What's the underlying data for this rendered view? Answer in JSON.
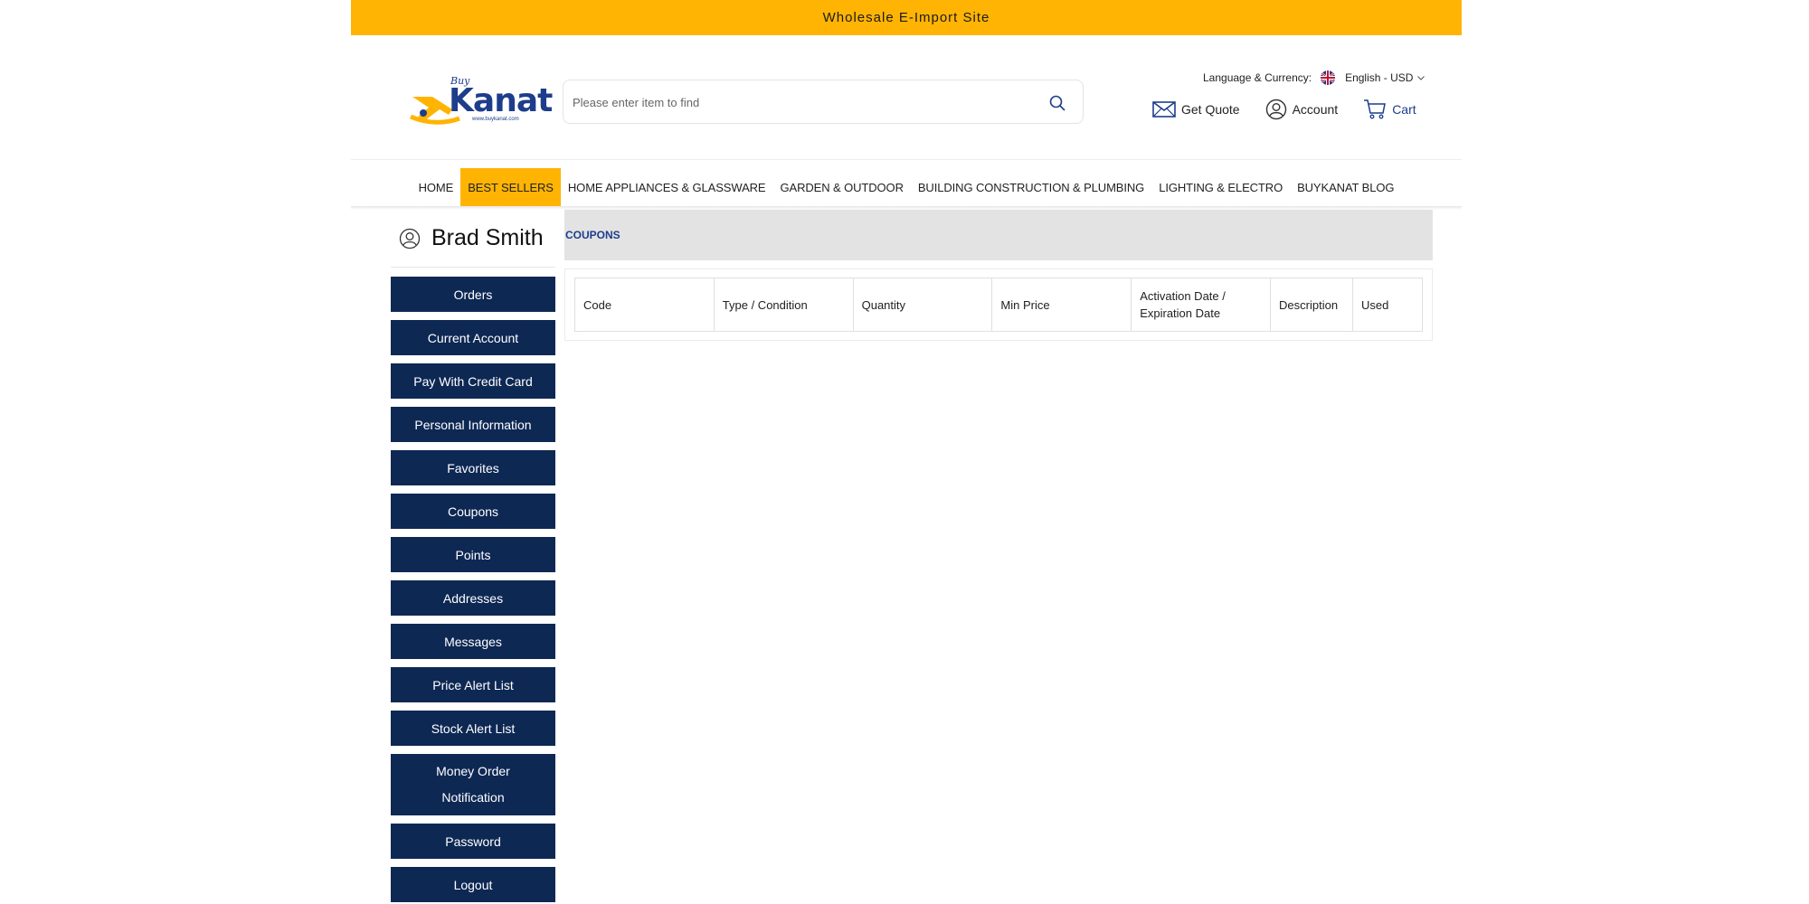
{
  "topbar": {
    "text": "Wholesale E-Import Site"
  },
  "logo": {
    "buy": "Buy",
    "name": "Kanat",
    "url": "www.buykanat.com"
  },
  "search": {
    "placeholder": "Please enter item to find"
  },
  "header": {
    "language_label": "Language & Currency:",
    "language_value": "English - USD",
    "get_quote": "Get Quote",
    "account": "Account",
    "cart": "Cart"
  },
  "nav": {
    "items": [
      {
        "label": "HOME"
      },
      {
        "label": "BEST SELLERS"
      },
      {
        "label": "HOME APPLIANCES & GLASSWARE"
      },
      {
        "label": "GARDEN & OUTDOOR"
      },
      {
        "label": "BUILDING CONSTRUCTION & PLUMBING"
      },
      {
        "label": "LIGHTING & ELECTRO"
      },
      {
        "label": "BUYKANAT BLOG"
      }
    ],
    "active_index": 1
  },
  "user": {
    "name": "Brad Smith"
  },
  "sidebar": {
    "items": [
      {
        "label": "Orders"
      },
      {
        "label": "Current Account"
      },
      {
        "label": "Pay With Credit Card"
      },
      {
        "label": "Personal Information"
      },
      {
        "label": "Favorites"
      },
      {
        "label": "Coupons"
      },
      {
        "label": "Points"
      },
      {
        "label": "Addresses"
      },
      {
        "label": "Messages"
      },
      {
        "label": "Price Alert List"
      },
      {
        "label": "Stock Alert List"
      },
      {
        "label": "Money Order Notification"
      },
      {
        "label": "Password"
      },
      {
        "label": "Logout"
      }
    ]
  },
  "page": {
    "title": "COUPONS"
  },
  "table": {
    "columns": [
      {
        "label": "Code"
      },
      {
        "label": "Type / Condition"
      },
      {
        "label": "Quantity"
      },
      {
        "label": "Min Price"
      },
      {
        "label": "Activation Date / Expiration Date"
      },
      {
        "label": "Description"
      },
      {
        "label": "Used"
      }
    ]
  },
  "colors": {
    "accent": "#ffb404",
    "navy": "#0e2854",
    "brand_blue": "#1d3d8c"
  },
  "icons": [
    "search-icon",
    "uk-flag-icon",
    "chevron-down-icon",
    "envelope-icon",
    "user-circle-icon",
    "cart-icon"
  ]
}
